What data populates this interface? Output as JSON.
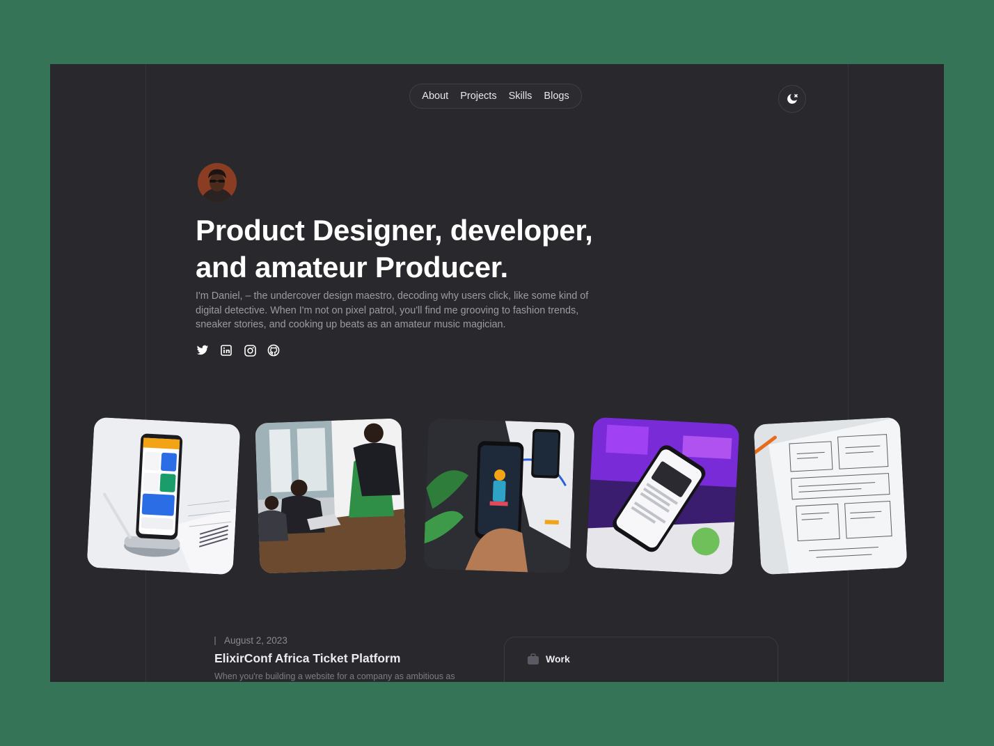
{
  "nav": {
    "items": [
      "About",
      "Projects",
      "Skills",
      "Blogs"
    ]
  },
  "theme_toggle": {
    "icon": "moon-icon"
  },
  "hero": {
    "headline_line1": "Product Designer, developer,",
    "headline_line2": "and amateur Producer.",
    "intro": "I'm Daniel, – the undercover design maestro, decoding why users click, like some kind of digital detective. When I'm not on pixel patrol, you'll find me grooving to fashion trends, sneaker stories, and cooking up beats as an amateur music magician."
  },
  "socials": [
    "twitter-icon",
    "linkedin-icon",
    "instagram-icon",
    "github-icon"
  ],
  "gallery": [
    {
      "subject": "phone on stand with weather app"
    },
    {
      "subject": "team meeting at office table"
    },
    {
      "subject": "hand holding phone with illustration"
    },
    {
      "subject": "phone on purple background"
    },
    {
      "subject": "wireframe sketches on paper"
    }
  ],
  "post": {
    "date": "August 2, 2023",
    "title": "ElixirConf Africa Ticket Platform",
    "excerpt": "When you're building a website for a company as ambitious as"
  },
  "work": {
    "label": "Work",
    "icon": "briefcase-icon"
  },
  "colors": {
    "page_bg": "#357457",
    "panel_bg": "#28282d",
    "text": "#ffffff",
    "muted": "#9b9ba3"
  }
}
